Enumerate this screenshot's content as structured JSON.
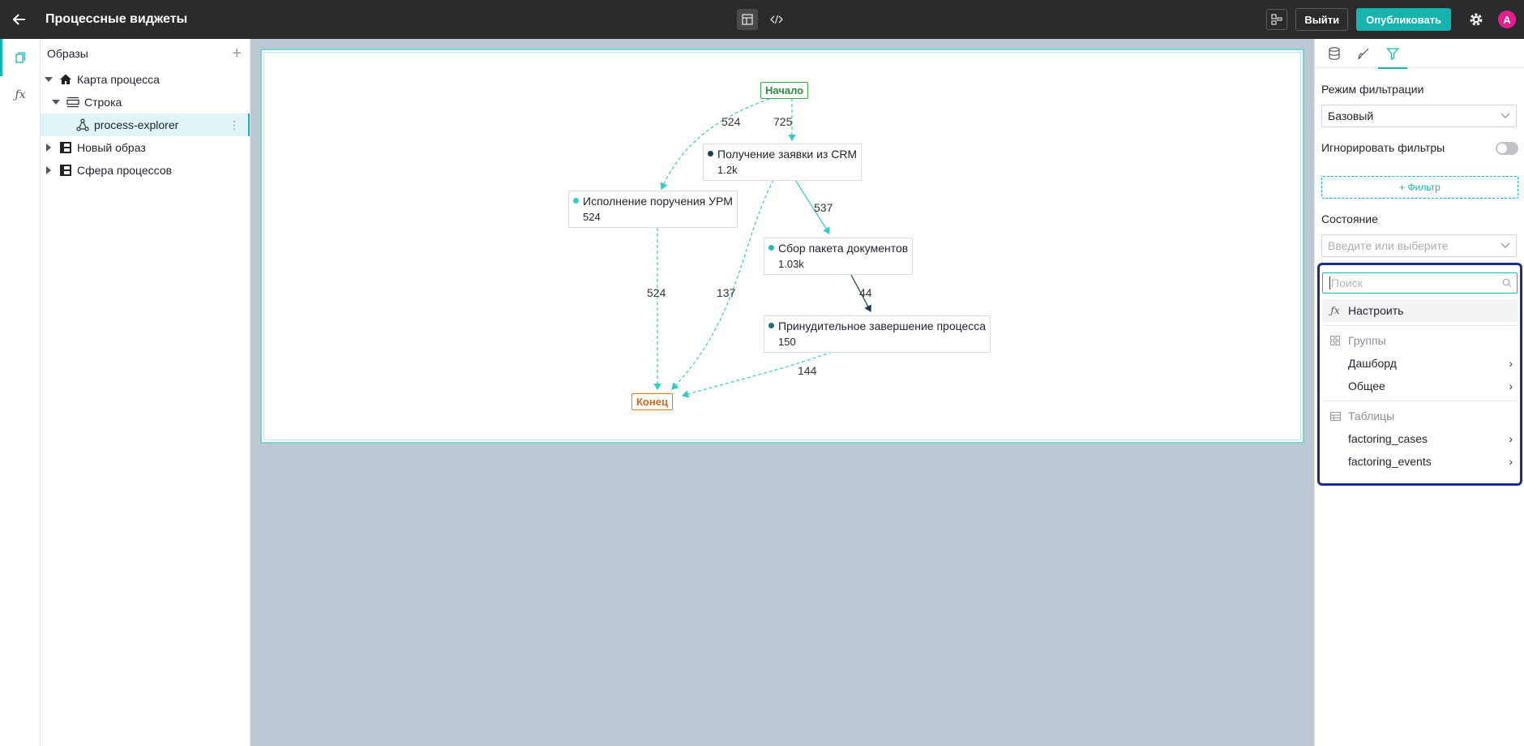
{
  "header": {
    "title": "Процессные виджеты",
    "exit_label": "Выйти",
    "publish_label": "Опубликовать",
    "avatar_letter": "A"
  },
  "tree": {
    "title": "Образы",
    "items": [
      {
        "label": "Карта процесса"
      },
      {
        "label": "Строка"
      },
      {
        "label": "process-explorer"
      },
      {
        "label": "Новый образ"
      },
      {
        "label": "Сфера процессов"
      }
    ]
  },
  "graph": {
    "start_label": "Начало",
    "end_label": "Конец",
    "nodes": [
      {
        "label": "Получение заявки из CRM",
        "count": "1.2k",
        "dot_color": "#1f3b4d"
      },
      {
        "label": "Исполнение поручения УРМ",
        "count": "524",
        "dot_color": "#3cc6c4"
      },
      {
        "label": "Сбор пакета документов",
        "count": "1.03k",
        "dot_color": "#2fb5b3"
      },
      {
        "label": "Принудительное завершение процесса",
        "count": "150",
        "dot_color": "#1f6e74"
      }
    ],
    "edges": [
      {
        "label": "524"
      },
      {
        "label": "725"
      },
      {
        "label": "537"
      },
      {
        "label": "524"
      },
      {
        "label": "137"
      },
      {
        "label": "44"
      },
      {
        "label": "144"
      }
    ]
  },
  "right_panel": {
    "filter_mode_label": "Режим фильтрации",
    "filter_mode_value": "Базовый",
    "ignore_filters_label": "Игнорировать фильтры",
    "add_filter_label": "+ Фильтр",
    "state_label": "Состояние",
    "state_placeholder": "Введите или выберите",
    "dropdown": {
      "search_placeholder": "Поиск",
      "configure_label": "Настроить",
      "groups_header": "Группы",
      "groups": [
        "Дашборд",
        "Общее"
      ],
      "tables_header": "Таблицы",
      "tables": [
        "factoring_cases",
        "factoring_events"
      ]
    }
  },
  "colors": {
    "accent": "#17b3b1",
    "topbar": "#2b2b2d",
    "canvas_bg": "#bcc8d3",
    "dropdown_border": "#1f2c8f",
    "start_green": "#2e8b3d",
    "end_orange": "#d2691e",
    "edge": "#3cc6c4"
  }
}
